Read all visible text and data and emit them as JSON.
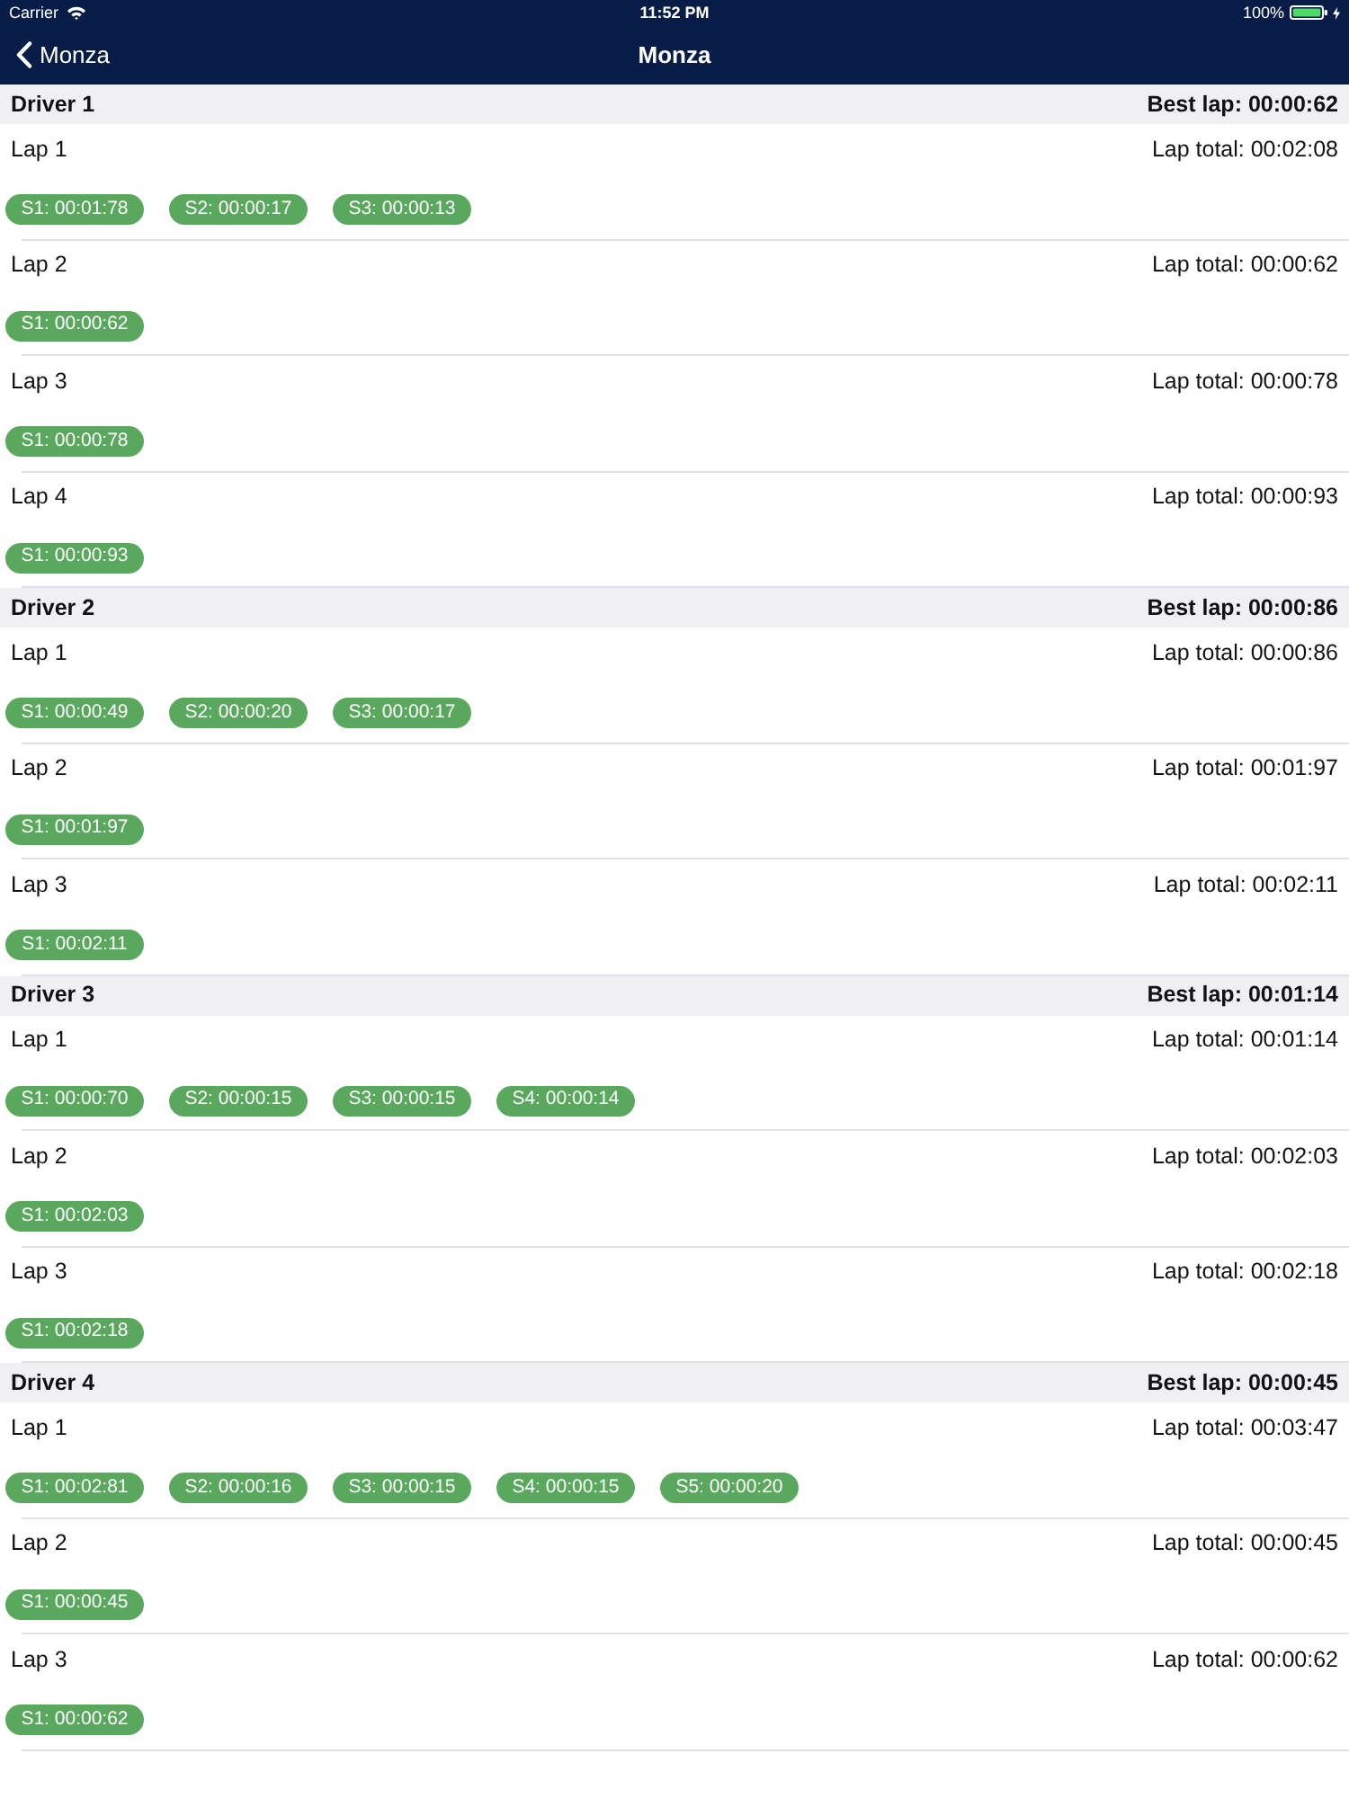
{
  "status_bar": {
    "carrier": "Carrier",
    "time": "11:52 PM",
    "battery": "100%"
  },
  "nav_bar": {
    "back": "Monza",
    "title": "Monza"
  },
  "drivers": [
    {
      "name": "Driver 1",
      "best_lap": "Best lap: 00:00:62",
      "laps": [
        {
          "name": "Lap 1",
          "total": "Lap total: 00:02:08",
          "sectors": [
            "S1: 00:01:78",
            "S2: 00:00:17",
            "S3: 00:00:13"
          ]
        },
        {
          "name": "Lap 2",
          "total": "Lap total: 00:00:62",
          "sectors": [
            "S1: 00:00:62"
          ]
        },
        {
          "name": "Lap 3",
          "total": "Lap total: 00:00:78",
          "sectors": [
            "S1: 00:00:78"
          ]
        },
        {
          "name": "Lap 4",
          "total": "Lap total: 00:00:93",
          "sectors": [
            "S1: 00:00:93"
          ]
        }
      ]
    },
    {
      "name": "Driver 2",
      "best_lap": "Best lap: 00:00:86",
      "laps": [
        {
          "name": "Lap 1",
          "total": "Lap total: 00:00:86",
          "sectors": [
            "S1: 00:00:49",
            "S2: 00:00:20",
            "S3: 00:00:17"
          ]
        },
        {
          "name": "Lap 2",
          "total": "Lap total: 00:01:97",
          "sectors": [
            "S1: 00:01:97"
          ]
        },
        {
          "name": "Lap 3",
          "total": "Lap total: 00:02:11",
          "sectors": [
            "S1: 00:02:11"
          ]
        }
      ]
    },
    {
      "name": "Driver 3",
      "best_lap": "Best lap: 00:01:14",
      "laps": [
        {
          "name": "Lap 1",
          "total": "Lap total: 00:01:14",
          "sectors": [
            "S1: 00:00:70",
            "S2: 00:00:15",
            "S3: 00:00:15",
            "S4: 00:00:14"
          ]
        },
        {
          "name": "Lap 2",
          "total": "Lap total: 00:02:03",
          "sectors": [
            "S1: 00:02:03"
          ]
        },
        {
          "name": "Lap 3",
          "total": "Lap total: 00:02:18",
          "sectors": [
            "S1: 00:02:18"
          ]
        }
      ]
    },
    {
      "name": "Driver 4",
      "best_lap": "Best lap: 00:00:45",
      "laps": [
        {
          "name": "Lap 1",
          "total": "Lap total: 00:03:47",
          "sectors": [
            "S1: 00:02:81",
            "S2: 00:00:16",
            "S3: 00:00:15",
            "S4: 00:00:15",
            "S5: 00:00:20"
          ]
        },
        {
          "name": "Lap 2",
          "total": "Lap total: 00:00:45",
          "sectors": [
            "S1: 00:00:45"
          ]
        },
        {
          "name": "Lap 3",
          "total": "Lap total: 00:00:62",
          "sectors": [
            "S1: 00:00:62"
          ]
        }
      ]
    }
  ]
}
